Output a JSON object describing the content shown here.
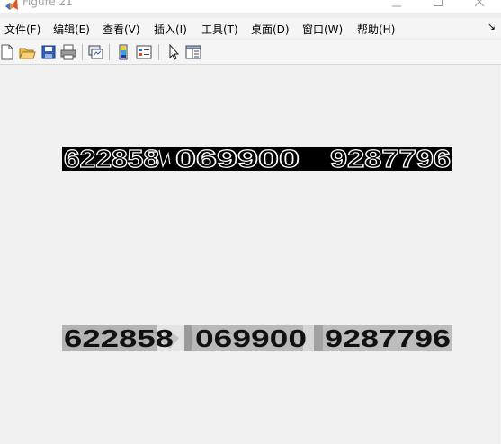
{
  "window": {
    "title": "Figure 21"
  },
  "menubar": {
    "items": [
      {
        "label": "文件(F)"
      },
      {
        "label": "编辑(E)"
      },
      {
        "label": "查看(V)"
      },
      {
        "label": "插入(I)"
      },
      {
        "label": "工具(T)"
      },
      {
        "label": "桌面(D)"
      },
      {
        "label": "窗口(W)"
      },
      {
        "label": "帮助(H)"
      }
    ],
    "overflow_symbol": "↘"
  },
  "toolbar": {
    "icons": [
      "new-figure-icon",
      "open-file-icon",
      "save-icon",
      "print-icon",
      "link-plot-icon",
      "insert-colorbar-icon",
      "insert-legend-icon",
      "edit-plot-arrow-icon",
      "property-inspector-icon"
    ]
  },
  "figure": {
    "top_image": {
      "groups": [
        "622858",
        "069900",
        "9287796"
      ],
      "style": "binary edge image, white outline digits on black"
    },
    "bottom_image": {
      "groups": [
        "622858",
        "069900",
        "9287796"
      ],
      "style": "grayscale image, black digits on gray"
    }
  },
  "colors": {
    "window_bg": "#f0f0f0",
    "titlebar_bg": "#ffffff",
    "title_text": "#a0a0a0",
    "strip_top_bg": "#000000",
    "strip_top_fg": "#ffffff",
    "strip_bottom_bg": "#b8b8b8",
    "strip_bottom_fg": "#111111"
  }
}
